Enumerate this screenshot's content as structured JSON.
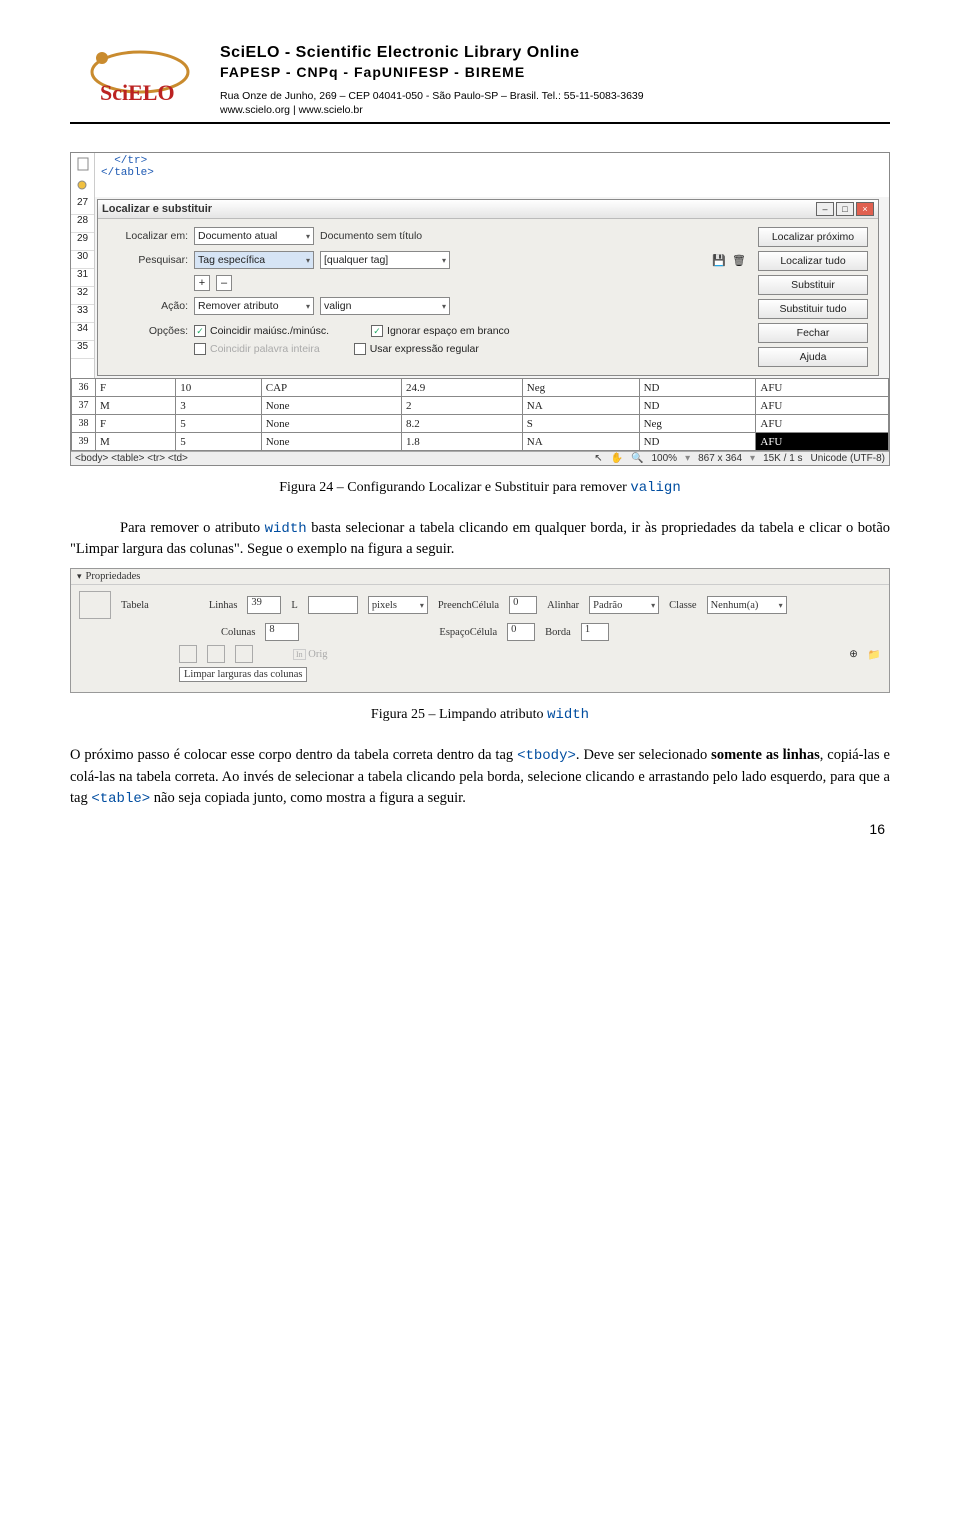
{
  "header": {
    "title": "SciELO - Scientific Electronic Library Online",
    "subtitle": "FAPESP - CNPq - FapUNIFESP - BIREME",
    "address": "Rua Onze de Junho, 269 – CEP 04041-050 - São Paulo-SP – Brasil. Tel.: 55-11-5083-3639",
    "site": "www.scielo.org | www.scielo.br"
  },
  "screenshot1": {
    "code_lines": [
      "  </tr>",
      "</table>"
    ],
    "dialog": {
      "title": "Localizar e substituir",
      "buttons_win_min": "–",
      "buttons_win_max": "□",
      "buttons_win_close": "×",
      "row_localizar_label": "Localizar em:",
      "row_localizar_value": "Documento atual",
      "row_localizar_extra": "Documento sem título",
      "btn_localizar_proximo": "Localizar próximo",
      "row_pesquisar_label": "Pesquisar:",
      "row_pesquisar_value": "Tag específica",
      "row_pesquisar_extra": "[qualquer tag]",
      "btn_localizar_tudo": "Localizar tudo",
      "plus": "+",
      "minus": "–",
      "btn_substituir": "Substituir",
      "row_acao_label": "Ação:",
      "row_acao_value": "Remover atributo",
      "row_acao_extra": "valign",
      "btn_substituir_tudo": "Substituir tudo",
      "row_opcoes_label": "Opções:",
      "chk_maiusc": "Coincidir maiúsc./minúsc.",
      "chk_ignorar": "Ignorar espaço em branco",
      "btn_fechar": "Fechar",
      "chk_palavra": "Coincidir palavra inteira",
      "chk_regex": "Usar expressão regular",
      "btn_ajuda": "Ajuda"
    },
    "gutter_lines": [
      "27",
      "28",
      "29",
      "30",
      "31",
      "32",
      "33",
      "34",
      "35"
    ],
    "table_rows": [
      {
        "ln": "36",
        "c1": "F",
        "c2": "10",
        "c3": "CAP",
        "c4": "24.9",
        "c5": "Neg",
        "c6": "ND",
        "c7": "AFU"
      },
      {
        "ln": "37",
        "c1": "M",
        "c2": "3",
        "c3": "None",
        "c4": "2",
        "c5": "NA",
        "c6": "ND",
        "c7": "AFU"
      },
      {
        "ln": "38",
        "c1": "F",
        "c2": "5",
        "c3": "None",
        "c4": "8.2",
        "c5": "S",
        "c6": "Neg",
        "c7": "AFU"
      },
      {
        "ln": "39",
        "c1": "M",
        "c2": "5",
        "c3": "None",
        "c4": "1.8",
        "c5": "NA",
        "c6": "ND",
        "c7": "AFU",
        "inv": true
      }
    ],
    "status_path": "<body> <table> <tr> <td>",
    "status_zoom": "100%",
    "status_dims": "867 x 364",
    "status_size": "15K / 1 s",
    "status_enc": "Unicode (UTF-8)"
  },
  "caption1_prefix": "Figura 24 – Configurando Localizar e Substituir para remover ",
  "caption1_blue": "valign",
  "para1_a": "Para remover o atributo ",
  "para1_b": "width",
  "para1_c": " basta selecionar a tabela clicando em qualquer borda, ir às propriedades da tabela e clicar o botão \"Limpar largura das colunas\". Segue o exemplo na figura a seguir.",
  "screenshot2": {
    "panel_title": "Propriedades",
    "lbl_tabela": "Tabela",
    "lbl_linhas": "Linhas",
    "val_linhas": "39",
    "lbl_l": "L",
    "sel_unid": "pixels",
    "lbl_preench": "PreenchCélula",
    "val_preench": "0",
    "lbl_alinhar": "Alinhar",
    "sel_alinhar": "Padrão",
    "lbl_classe": "Classe",
    "sel_classe": "Nenhum(a)",
    "lbl_colunas": "Colunas",
    "val_colunas": "8",
    "lbl_espaco": "EspaçoCélula",
    "val_espaco": "0",
    "lbl_borda": "Borda",
    "val_borda": "1",
    "btn_limpar": "Limpar larguras das colunas",
    "lbl_orig": "Orig"
  },
  "caption2_prefix": "Figura 25 – Limpando atributo ",
  "caption2_blue": "width",
  "para2_a": "O próximo passo é colocar esse corpo dentro da tabela correta dentro da tag ",
  "para2_tbody": "<tbody>",
  "para2_b": ". Deve ser selecionado ",
  "para2_bold": "somente as linhas",
  "para2_c": ", copiá-las e colá-las na tabela correta. Ao invés de selecionar a tabela clicando pela borda, selecione clicando e arrastando pelo lado esquerdo, para que a tag ",
  "para2_table": "<table>",
  "para2_d": " não seja copiada junto, como mostra a figura a seguir.",
  "pagenum": "16"
}
